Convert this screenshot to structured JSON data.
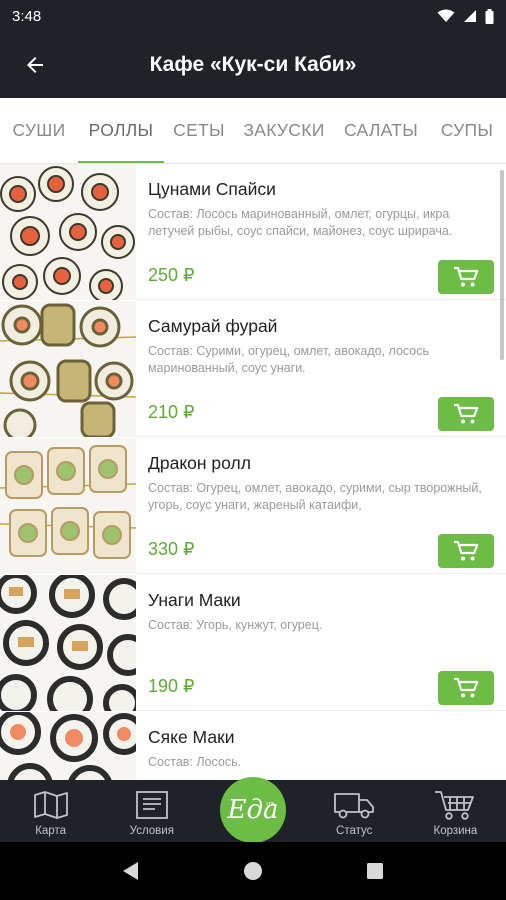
{
  "status_bar": {
    "time": "3:48"
  },
  "header": {
    "title": "Кафе «Кук-си Каби»"
  },
  "tabs": [
    {
      "label": "СУШИ",
      "active": false
    },
    {
      "label": "РОЛЛЫ",
      "active": true
    },
    {
      "label": "СЕТЫ",
      "active": false
    },
    {
      "label": "ЗАКУСКИ",
      "active": false
    },
    {
      "label": "САЛАТЫ",
      "active": false
    },
    {
      "label": "СУПЫ",
      "active": false
    }
  ],
  "items": [
    {
      "name": "Цунами Спайси",
      "description": "Состав: Лосось маринованный, омлет, огурцы, икра летучей рыбы, соус спайси, майонез, соус шрирача.",
      "price": "250 ₽"
    },
    {
      "name": "Самурай фурай",
      "description": "Состав: Сурими, огурец, омлет, авокадо, лосось маринованный, соус унаги.",
      "price": "210 ₽"
    },
    {
      "name": "Дракон ролл",
      "description": "Состав: Огурец, омлет, авокадо, сурими, сыр творожный, угорь, соус унаги, жареный катаифи,",
      "price": "330 ₽"
    },
    {
      "name": "Унаги Маки",
      "description": "Состав: Угорь, кунжут, огурец.",
      "price": "190 ₽"
    },
    {
      "name": "Сяке Маки",
      "description": "Состав: Лосось.",
      "price": ""
    }
  ],
  "bottom_nav": {
    "map": "Карта",
    "terms": "Условия",
    "logo_text": "Еда",
    "logo_sup": "ua",
    "status": "Статус",
    "cart": "Корзина"
  },
  "colors": {
    "accent": "#6cbc45",
    "bar": "#1f2328",
    "price": "#5faa35"
  },
  "icons": [
    "wifi-icon",
    "signal-icon",
    "battery-icon",
    "back-arrow-icon",
    "cart-icon",
    "map-icon",
    "document-icon",
    "truck-icon",
    "basket-icon",
    "back-triangle-icon",
    "home-circle-icon",
    "recents-square-icon"
  ]
}
